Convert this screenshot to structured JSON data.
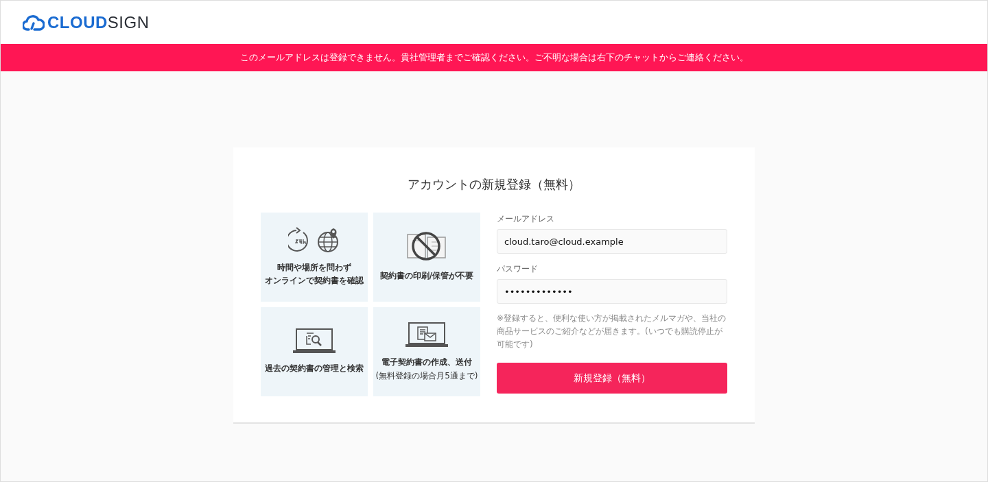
{
  "logo": {
    "part_1": "CLOUD",
    "part_2": "SIGN"
  },
  "alert": "このメールアドレスは登録できません。貴社管理者までご確認ください。ご不明な場合は右下のチャットからご連絡ください。",
  "card": {
    "title": "アカウントの新規登録（無料）",
    "features": [
      {
        "kind": "clock-globe",
        "title": "時間や場所を問わず",
        "title_line_2": "オンラインで契約書を確認"
      },
      {
        "kind": "no-paper",
        "title": "契約書の印刷/保管が不要"
      },
      {
        "kind": "laptop-search",
        "title": "過去の契約書の管理と検索"
      },
      {
        "kind": "laptop-mail",
        "title": "電子契約書の作成、送付",
        "note": "(無料登録の場合月5通まで)"
      }
    ],
    "fields": [
      {
        "label": "メールアドレス",
        "value": "cloud.taro@cloud.example"
      },
      {
        "label": "パスワード",
        "value": "•••••••••••••"
      }
    ],
    "notice": "※登録すると、便利な使い方が掲載されたメルマガや、当社の商品サービスのご紹介などが届きます。(いつでも購読停止が可能です)",
    "submit": "新規登録（無料）"
  }
}
